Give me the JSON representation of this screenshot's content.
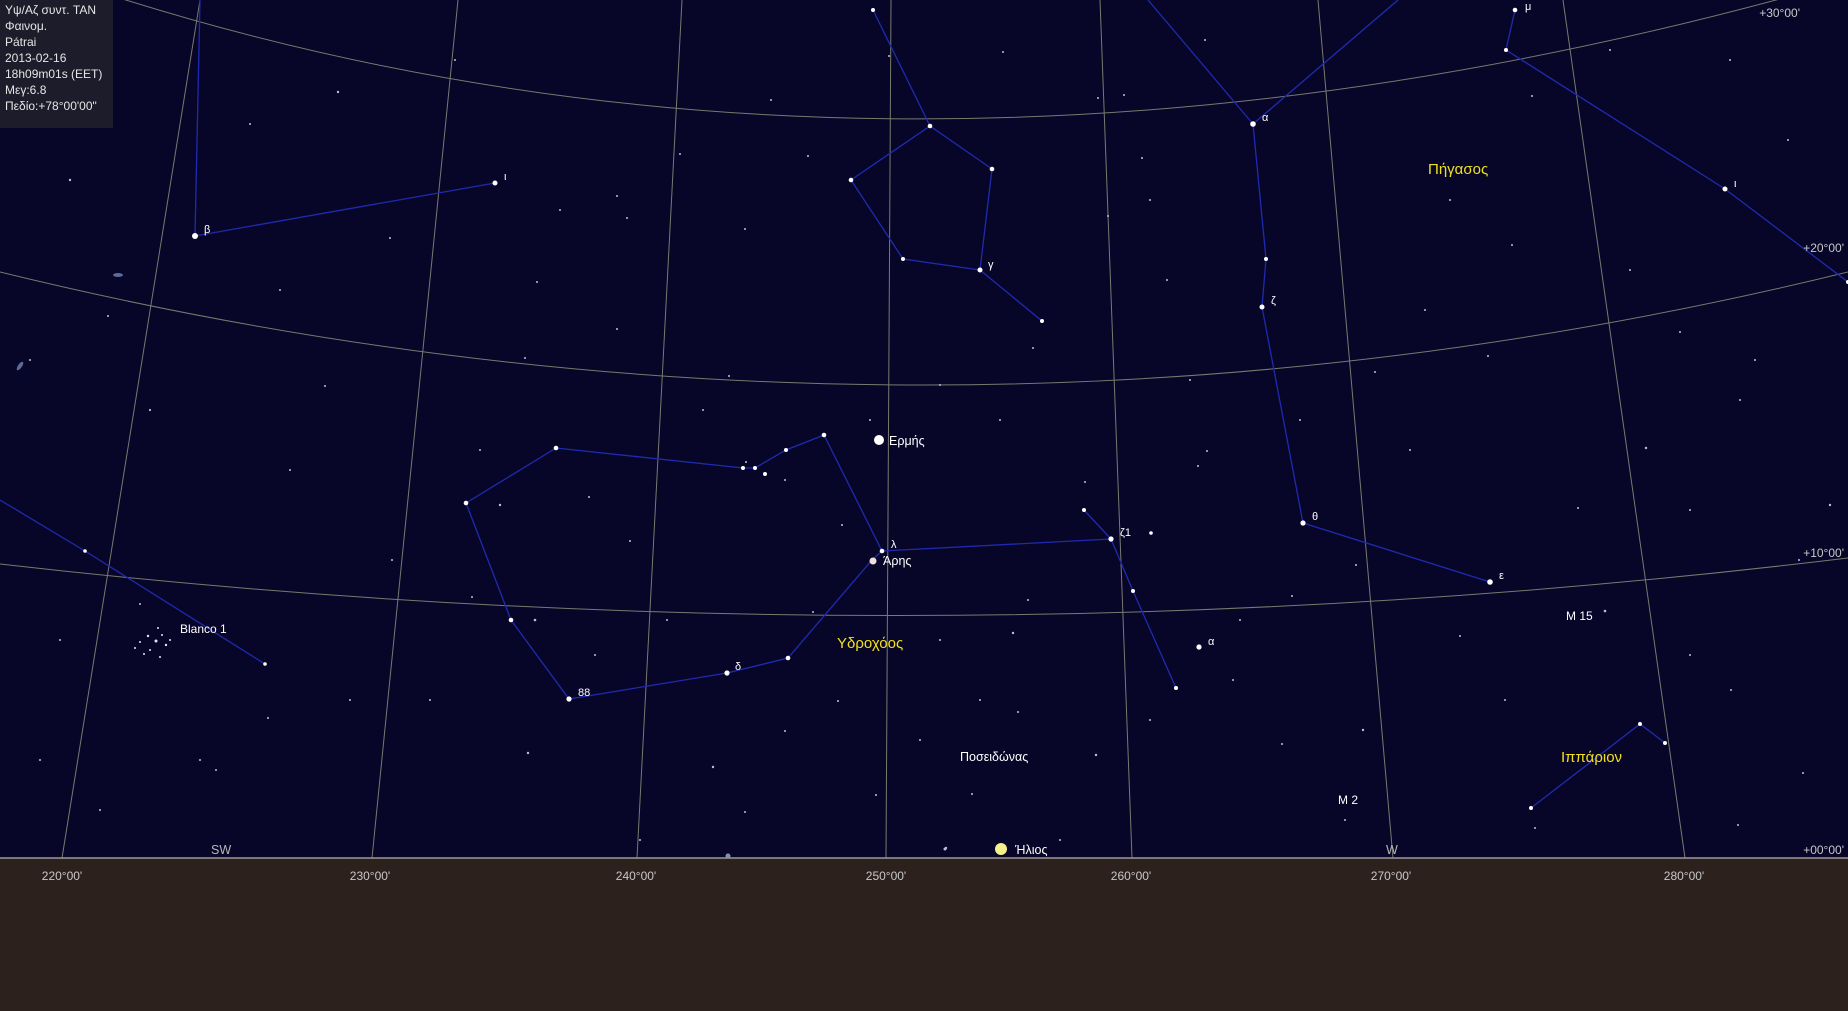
{
  "info_panel": {
    "lines": [
      "Υψ/Αζ συντ. TAN",
      "Φαινομ.",
      "Pátrai",
      "2013-02-16",
      "18h09m01s (EET)",
      "Μεγ:6.8",
      "Πεδίο:+78°00'00\""
    ]
  },
  "azimuth_labels": [
    "220°00'",
    "230°00'",
    "240°00'",
    "250°00'",
    "260°00'",
    "270°00'",
    "280°00'"
  ],
  "altitude_labels": [
    "+30°00'",
    "+20°00'",
    "+10°00'",
    "+00°00'"
  ],
  "horizon_markers": [
    "SW",
    "W"
  ],
  "constellations": [
    "Πήγασος",
    "Υδροχόος",
    "Ιππάριον"
  ],
  "planets": [
    "Ερμής",
    "Άρης",
    "Ποσειδώνας",
    "Ήλιος"
  ],
  "deep_sky": [
    "Blanco 1",
    "M 15",
    "M 2"
  ],
  "star_labels": {
    "mu": "μ",
    "alpha_peg": "α",
    "iota_peg": "ι",
    "zeta_peg": "ζ",
    "theta_peg": "θ",
    "epsilon_peg": "ε",
    "beta": "β",
    "iota_psa": "ι",
    "gamma": "γ",
    "lambda": "λ",
    "zeta1": "ζ1",
    "alpha_aqr": "α",
    "delta": "δ",
    "n88": "88"
  },
  "colors": {
    "sky": "#080628",
    "ground": "#2d211e",
    "grid": "#777a6e",
    "constellation_lines": "#1f2ab0",
    "constellation_names": "#f0e020",
    "labels": "#ffffff",
    "sun": "#f5f08a"
  }
}
